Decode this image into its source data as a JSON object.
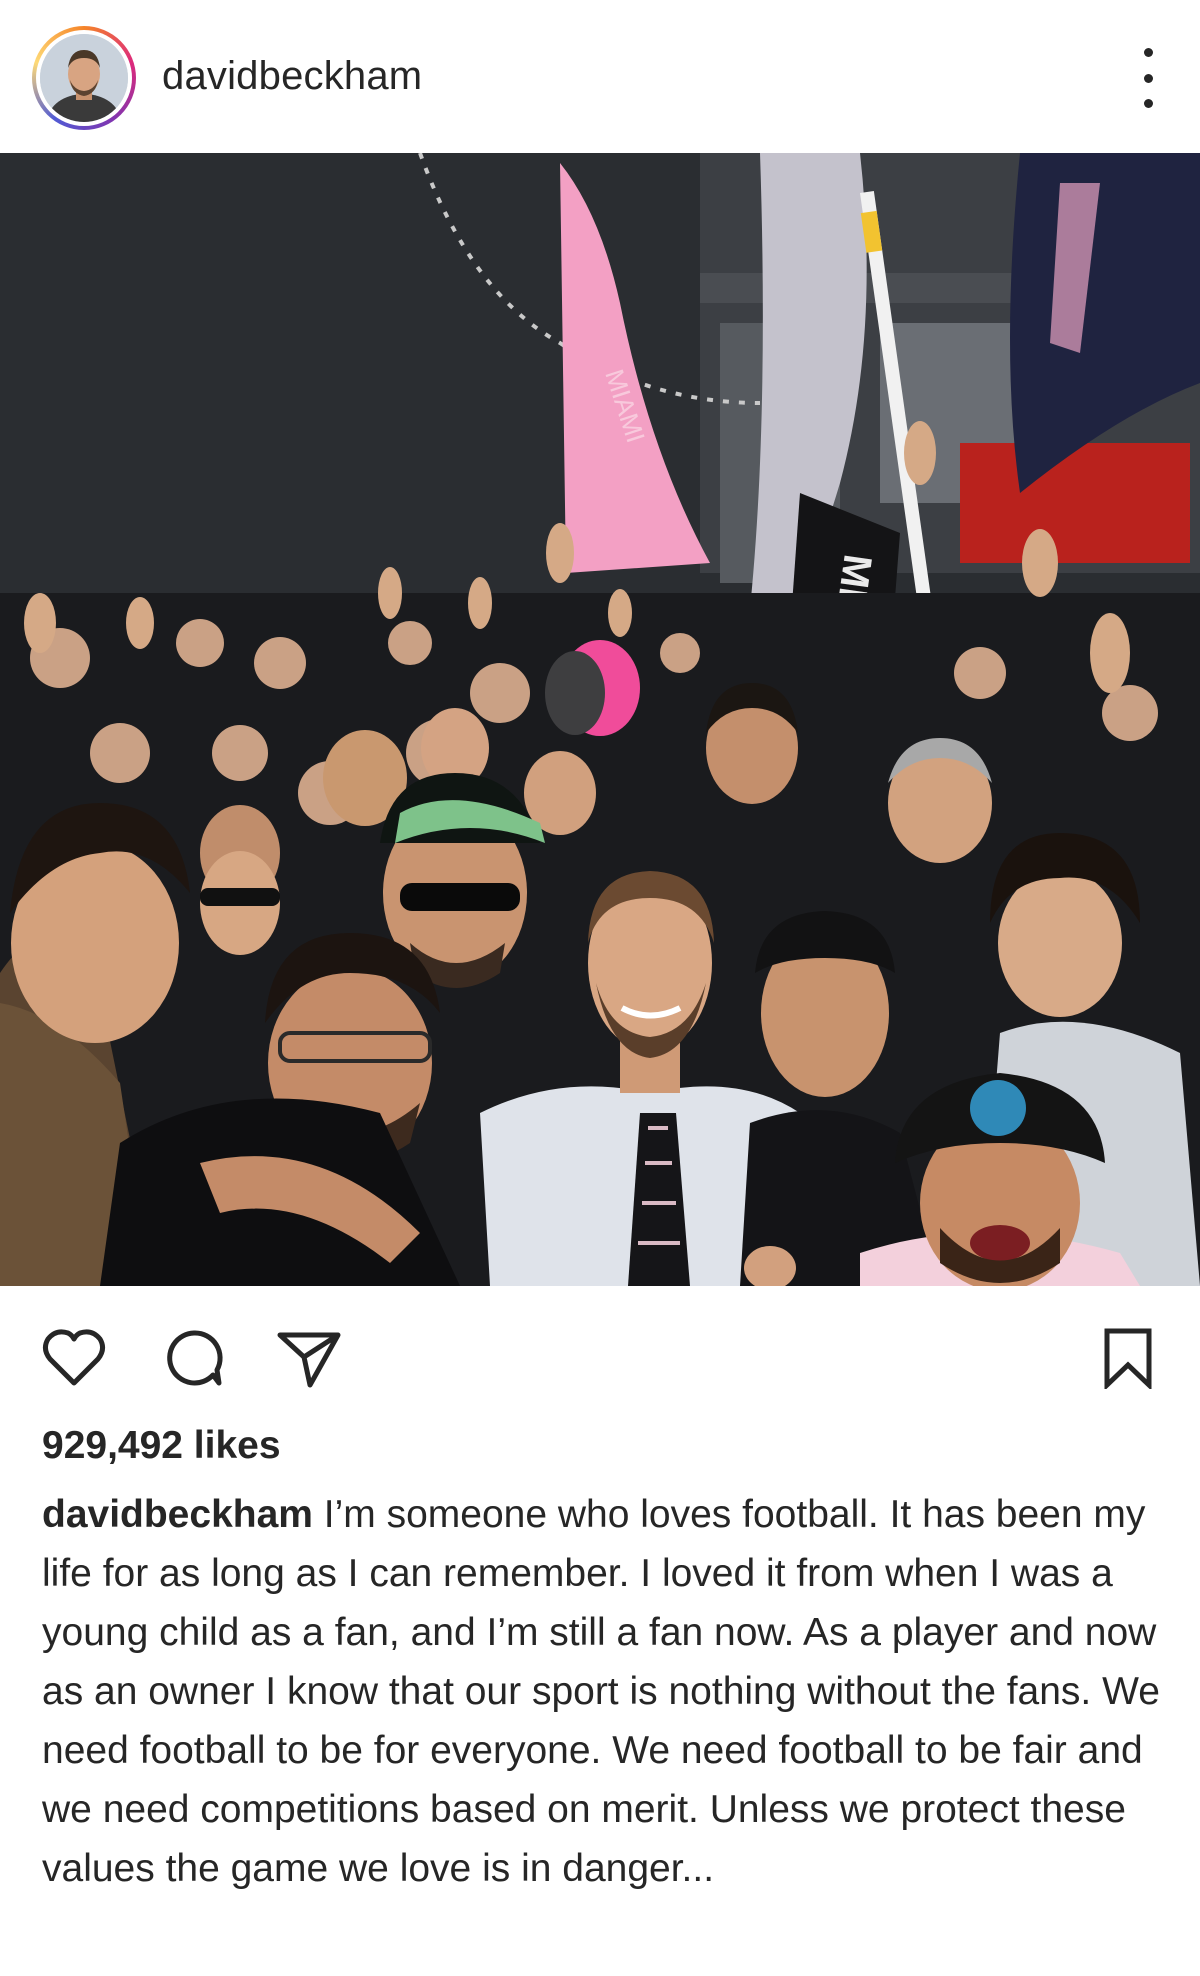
{
  "header": {
    "username": "davidbeckham",
    "avatar_icon": "profile-avatar",
    "more_icon": "more-options-icon"
  },
  "photo": {
    "flag_text_1": "MIAMI",
    "flag_text_2": "MIAMI",
    "colors": {
      "pink": "#f3a0c4",
      "wall": "#2a2d31",
      "sky": "#d9dcdf"
    }
  },
  "actions": {
    "like_icon": "heart-icon",
    "comment_icon": "comment-icon",
    "share_icon": "paper-plane-icon",
    "save_icon": "bookmark-icon"
  },
  "likes": {
    "text": "929,492 likes"
  },
  "caption": {
    "username": "davidbeckham",
    "text": " I’m someone who loves football. It has been my life for as long as I can remember. I loved it from when I was a young child as a fan, and I’m still a fan now. As a player and now as an owner I know that our sport is nothing without the fans. We need football to be for everyone. We need football to be fair and we need competitions based on merit. Unless we protect these values the game we love is in danger..."
  }
}
